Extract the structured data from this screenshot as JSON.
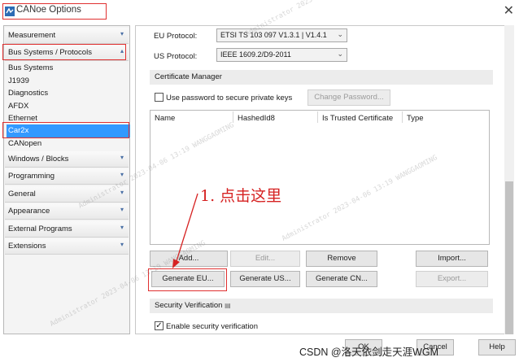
{
  "window": {
    "title": "CANoe Options"
  },
  "left_nav": {
    "categories_top": [
      {
        "label": "Measurement",
        "expanded": false
      }
    ],
    "active_category": {
      "label": "Bus Systems / Protocols",
      "expanded": true
    },
    "sub_items": [
      "Bus Systems",
      "J1939",
      "Diagnostics",
      "AFDX",
      "Ethernet",
      "Car2x",
      "CANopen"
    ],
    "selected_sub_item": "Car2x",
    "categories_bottom": [
      "Windows / Blocks",
      "Programming",
      "General",
      "Appearance",
      "External Programs",
      "Extensions"
    ]
  },
  "right": {
    "eu_protocol_label": "EU Protocol:",
    "eu_protocol_value": "ETSI TS 103 097 V1.3.1 | V1.4.1",
    "us_protocol_label": "US Protocol:",
    "us_protocol_value": "IEEE 1609.2/D9-2011",
    "cert_manager_title": "Certificate Manager",
    "use_password_label": "Use password to secure private keys",
    "use_password_checked": false,
    "change_password_button": "Change Password...",
    "table_headers": [
      "Name",
      "HashedId8",
      "Is Trusted Certificate",
      "Type"
    ],
    "buttons_row1": [
      "Add...",
      "Edit...",
      "Remove",
      "Import..."
    ],
    "buttons_row2": [
      "Generate EU...",
      "Generate US...",
      "Generate CN...",
      "Export..."
    ],
    "security_verification_title": "Security Verification",
    "enable_security_label": "Enable security verification",
    "enable_security_checked": true
  },
  "footer": {
    "ok_button": "OK",
    "cancel_button": "Cancel",
    "help_button": "Help",
    "credit": "CSDN @洛天依剑走天涯WGM"
  },
  "annotation": {
    "text": "1. 点击这里"
  },
  "watermark": {
    "text": "Administrator 2023-04-06 13:19 WANGGAOMING"
  },
  "colors": {
    "highlight_red": "#e03030",
    "selection_blue": "#3399ff",
    "annotation_red": "#d62222"
  }
}
